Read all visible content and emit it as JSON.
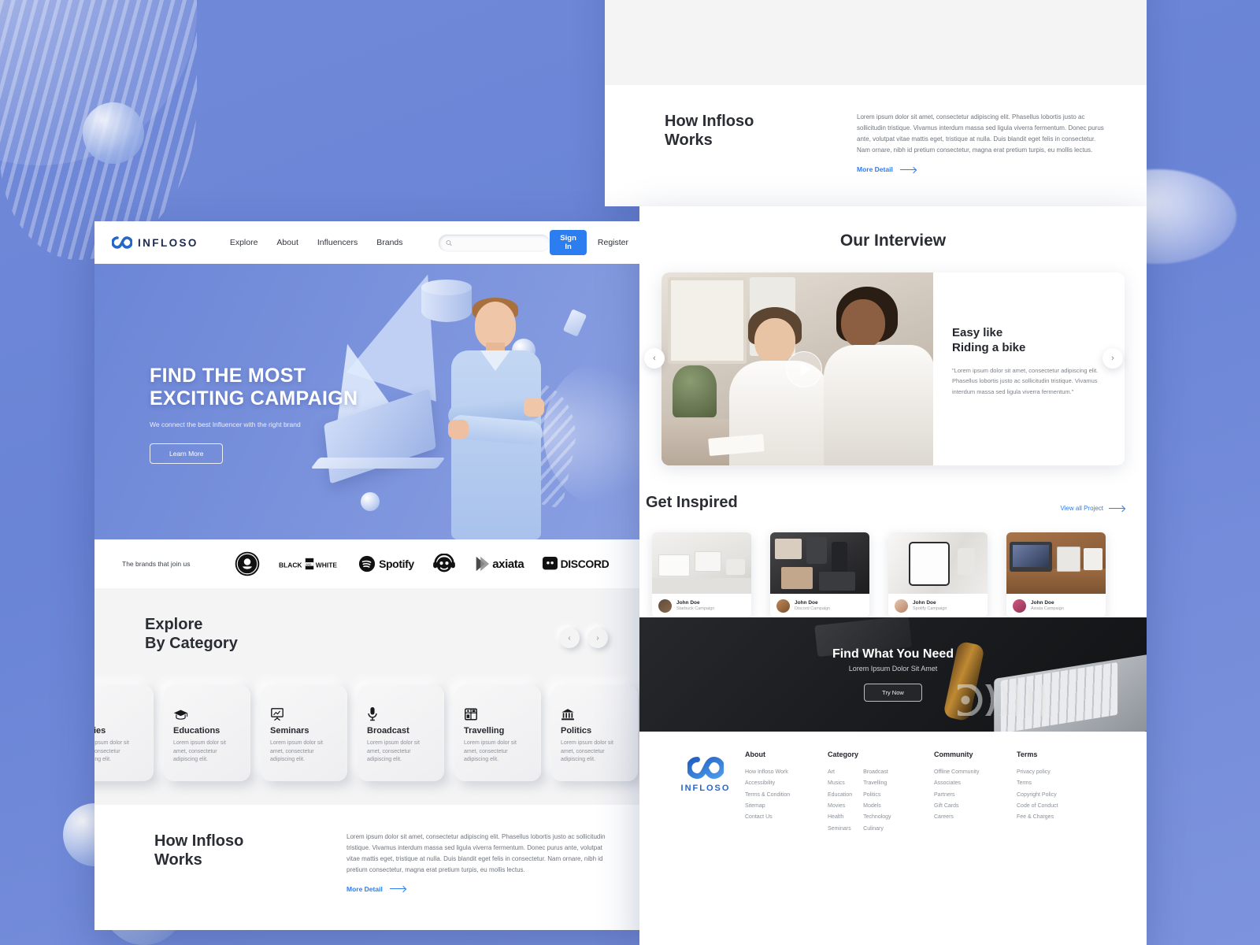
{
  "brand": {
    "name": "INFLOSO",
    "accent": "#2c7df0",
    "hero_bg": "#6d86d4"
  },
  "nav": {
    "links": [
      "Explore",
      "About",
      "Influencers",
      "Brands"
    ],
    "search_placeholder": "",
    "search_value": "",
    "sign_in": "Sign In",
    "register": "Register"
  },
  "hero": {
    "title": "FIND THE MOST EXCITING CAMPAIGN",
    "subtitle": "We connect the best Influencer with the right brand",
    "cta": "Learn More"
  },
  "brands_strip": {
    "label": "The brands that join us",
    "logos": [
      "Starbucks",
      "BLACK AND WHITE",
      "Spotify",
      "Headphone Mascot",
      "axiata",
      "DISCORD"
    ]
  },
  "explore": {
    "title_line1": "Explore",
    "title_line2": "By Category",
    "prev": "‹",
    "next": "›",
    "cards": [
      {
        "name": "Movies",
        "desc": "Lorem ipsum dolor sit amet, consectetur adipiscing elit.",
        "icon": "film-icon"
      },
      {
        "name": "Educations",
        "desc": "Lorem ipsum dolor sit amet, consectetur adipiscing elit.",
        "icon": "graduation-cap-icon"
      },
      {
        "name": "Seminars",
        "desc": "Lorem ipsum dolor sit amet, consectetur adipiscing elit.",
        "icon": "presentation-icon"
      },
      {
        "name": "Broadcast",
        "desc": "Lorem ipsum dolor sit amet, consectetur adipiscing elit.",
        "icon": "microphone-icon"
      },
      {
        "name": "Travelling",
        "desc": "Lorem ipsum dolor sit amet, consectetur adipiscing elit.",
        "icon": "map-icon"
      },
      {
        "name": "Politics",
        "desc": "Lorem ipsum dolor sit amet, consectetur adipiscing elit.",
        "icon": "bank-icon"
      }
    ]
  },
  "how_works": {
    "title_line1": "How Infloso",
    "title_line2": "Works",
    "body": "Lorem ipsum dolor sit amet, consectetur adipiscing elit. Phasellus lobortis justo ac sollicitudin tristique. Vivamus interdum massa sed ligula viverra fermentum. Donec purus ante, volutpat vitae mattis eget, tristique at nulla. Duis blandit eget felis in consectetur. Nam ornare, nibh id pretium consectetur, magna erat pretium turpis, eu mollis lectus.",
    "more": "More Detail"
  },
  "interview": {
    "title": "Our Interview",
    "headline_line1": "Easy like",
    "headline_line2": "Riding a bike",
    "quote": "\"Lorem ipsum dolor sit amet, consectetur adipiscing elit. Phasellus lobortis justo ac sollicitudin tristique. Vivamus interdum massa sed ligula viverra fermentum.\"",
    "prev": "‹",
    "next": "›"
  },
  "inspired": {
    "title": "Get Inspired",
    "view_all": "View all Project",
    "projects": [
      {
        "author": "John Doe",
        "campaign": "Starbuck Campaign"
      },
      {
        "author": "John Doe",
        "campaign": "Discord Campaign"
      },
      {
        "author": "John Doe",
        "campaign": "Spotify Campaign"
      },
      {
        "author": "John Doe",
        "campaign": "Axiata Campaign"
      }
    ]
  },
  "cta": {
    "title": "Find What You Need",
    "subtitle": "Lorem Ipsum Dolor Sit Amet",
    "button": "Try Now"
  },
  "footer": {
    "logo_text": "INFLOSO",
    "columns": [
      {
        "title": "About",
        "items": [
          "How Infloso Work",
          "Accessibility",
          "Terms & Condition",
          "Sitemap",
          "Contact Us"
        ]
      },
      {
        "title": "Category",
        "items": [
          "Art",
          "Musics",
          "Education",
          "Movies",
          "Health",
          "Seminars"
        ],
        "items2": [
          "Broadcast",
          "Travelling",
          "Politics",
          "Models",
          "Technology",
          "Culinary"
        ]
      },
      {
        "title": "Community",
        "items": [
          "Offline Community",
          "Associates",
          "Partners",
          "Gift Cards",
          "Careers"
        ]
      },
      {
        "title": "Terms",
        "items": [
          "Privacy policy",
          "Terms",
          "Copyright Policy",
          "Code of Conduct",
          "Fee & Charges"
        ]
      }
    ]
  }
}
